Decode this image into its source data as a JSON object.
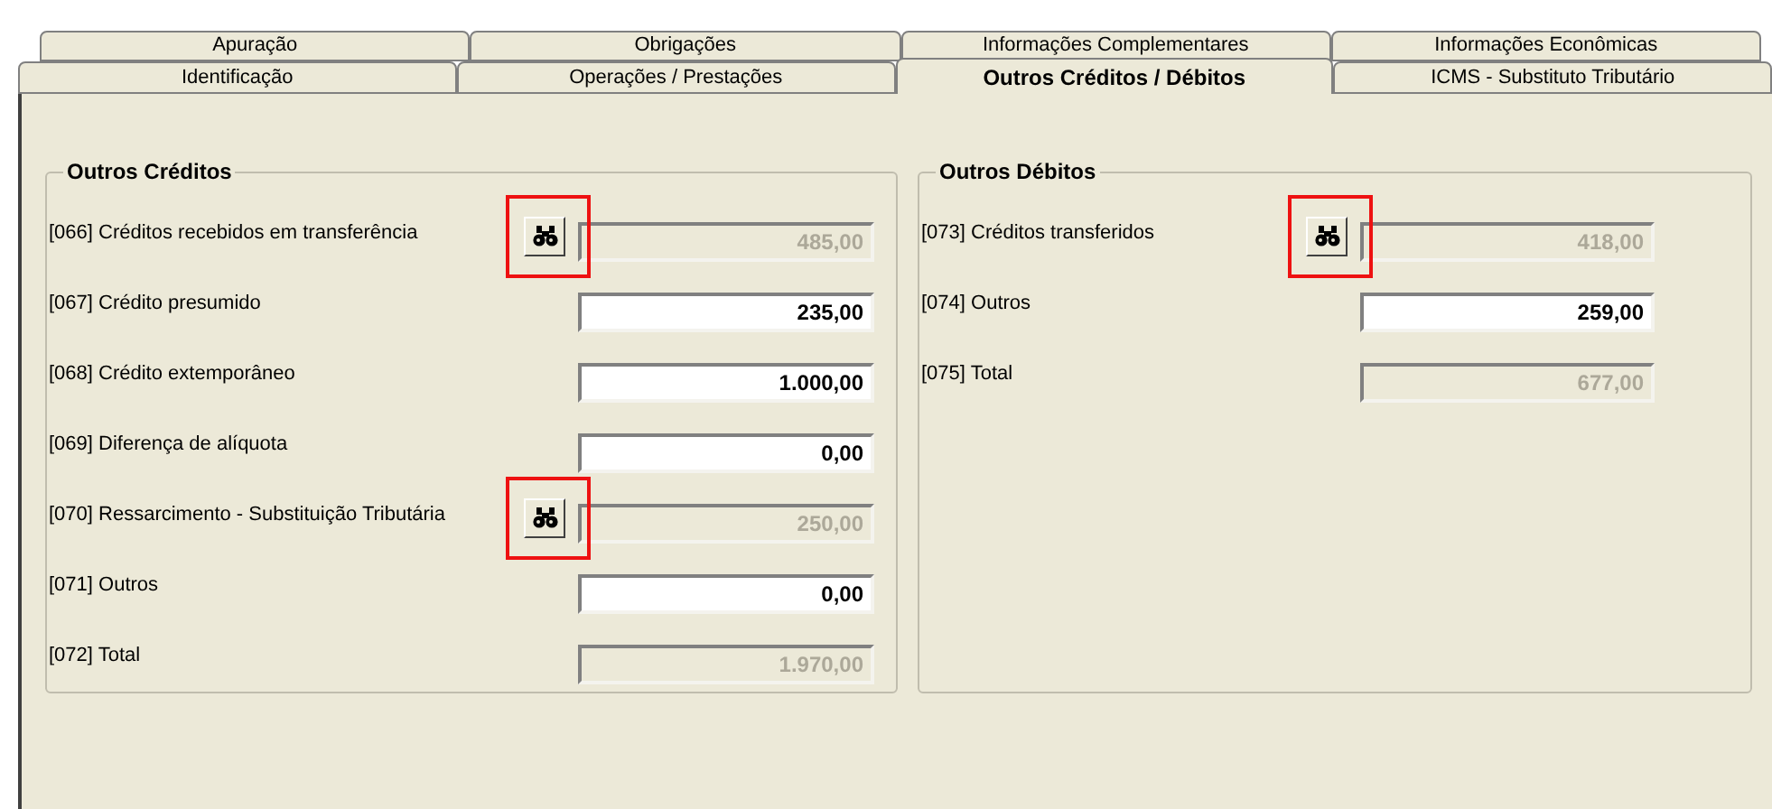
{
  "tab_rows": [
    [
      {
        "label": "Apuração",
        "selected": false
      },
      {
        "label": "Obrigações",
        "selected": false
      },
      {
        "label": "Informações Complementares",
        "selected": false
      },
      {
        "label": "Informações Econômicas",
        "selected": false
      }
    ],
    [
      {
        "label": "Identificação",
        "selected": false
      },
      {
        "label": "Operações / Prestações",
        "selected": false
      },
      {
        "label": "Outros Créditos / Débitos",
        "selected": true
      },
      {
        "label": "ICMS - Substituto Tributário",
        "selected": false
      }
    ]
  ],
  "groups": [
    {
      "title": "Outros Créditos",
      "fields": [
        {
          "label": "[066] Créditos recebidos em transferência",
          "value": "485,00",
          "kind": "lookup",
          "highlighted": true
        },
        {
          "label": "[067] Crédito presumido",
          "value": "235,00",
          "kind": "input",
          "highlighted": false
        },
        {
          "label": "[068] Crédito extemporâneo",
          "value": "1.000,00",
          "kind": "input",
          "highlighted": false
        },
        {
          "label": "[069] Diferença de alíquota",
          "value": "0,00",
          "kind": "input",
          "highlighted": false
        },
        {
          "label": "[070] Ressarcimento - Substituição Tributária",
          "value": "250,00",
          "kind": "lookup",
          "highlighted": true
        },
        {
          "label": "[071] Outros",
          "value": "0,00",
          "kind": "input",
          "highlighted": false
        },
        {
          "label": "[072] Total",
          "value": "1.970,00",
          "kind": "total",
          "highlighted": false
        }
      ]
    },
    {
      "title": "Outros Débitos",
      "fields": [
        {
          "label": "[073] Créditos transferidos",
          "value": "418,00",
          "kind": "lookup",
          "highlighted": true
        },
        {
          "label": "[074] Outros",
          "value": "259,00",
          "kind": "input",
          "highlighted": false
        },
        {
          "label": "[075] Total",
          "value": "677,00",
          "kind": "total",
          "highlighted": false
        }
      ]
    }
  ]
}
